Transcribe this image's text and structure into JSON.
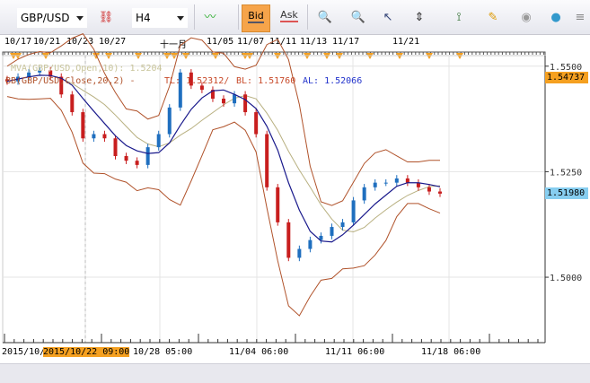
{
  "toolbar": {
    "symbol": "GBP/USD",
    "timeframe": "H4",
    "bid_label": "Bid",
    "ask_label": "Ask",
    "icons": [
      "link-remove-icon",
      "chart-type-icon",
      "zoom-in-icon",
      "zoom-out-icon",
      "cursor-icon",
      "zoom-vertical-icon",
      "fit-vertical-icon",
      "edit-icon",
      "eye-icon",
      "globe-icon",
      "menu-icon"
    ]
  },
  "top_axis_labels": [
    "10/17",
    "10/21",
    "10/23",
    "10/27",
    "十一月",
    "11/05",
    "11/07",
    "11/11",
    "11/13",
    "11/17",
    "11/21"
  ],
  "bottom_axis_labels": [
    "2015/10/",
    "2015/10/22 09:00",
    "10/28 05:00",
    "11/04 06:00",
    "11/11 06:00",
    "11/18 06:00"
  ],
  "legend": {
    "mva": "MVA(GBP/USD,Open,10): 1.5204",
    "bb": "BB(GBP/USD,Close,20,2) -",
    "tl": "TL: 1.52312/",
    "bl": "BL: 1.51760",
    "al": "AL: 1.52066"
  },
  "price_tags": {
    "top": "1.54737",
    "current": "1.51980"
  },
  "colors": {
    "up": "#1f6fbf",
    "down": "#c81e1e",
    "ma": "#1a1a8c",
    "bb": "#b0522a",
    "bb_mid": "#b8b080",
    "highlight": "#f5a020",
    "current": "#87cef0"
  },
  "chart_data": {
    "type": "candlestick",
    "y_ticks": [
      1.55,
      1.525,
      1.5
    ],
    "y_tick_labels": [
      "1.5500",
      "1.5250",
      "1.5000"
    ],
    "ylim": [
      1.4845,
      1.5525
    ],
    "closes": [
      1.5464,
      1.5475,
      1.5485,
      1.549,
      1.5475,
      1.5433,
      1.5391,
      1.5329,
      1.5339,
      1.5329,
      1.5287,
      1.5276,
      1.5266,
      1.5308,
      1.5339,
      1.5402,
      1.5485,
      1.5454,
      1.5444,
      1.5423,
      1.5412,
      1.5433,
      1.5391,
      1.5339,
      1.5213,
      1.513,
      1.5046,
      1.5067,
      1.5088,
      1.5098,
      1.5119,
      1.513,
      1.5182,
      1.5213,
      1.5224,
      1.5224,
      1.5234,
      1.5224,
      1.5213,
      1.5203,
      1.5198
    ]
  }
}
